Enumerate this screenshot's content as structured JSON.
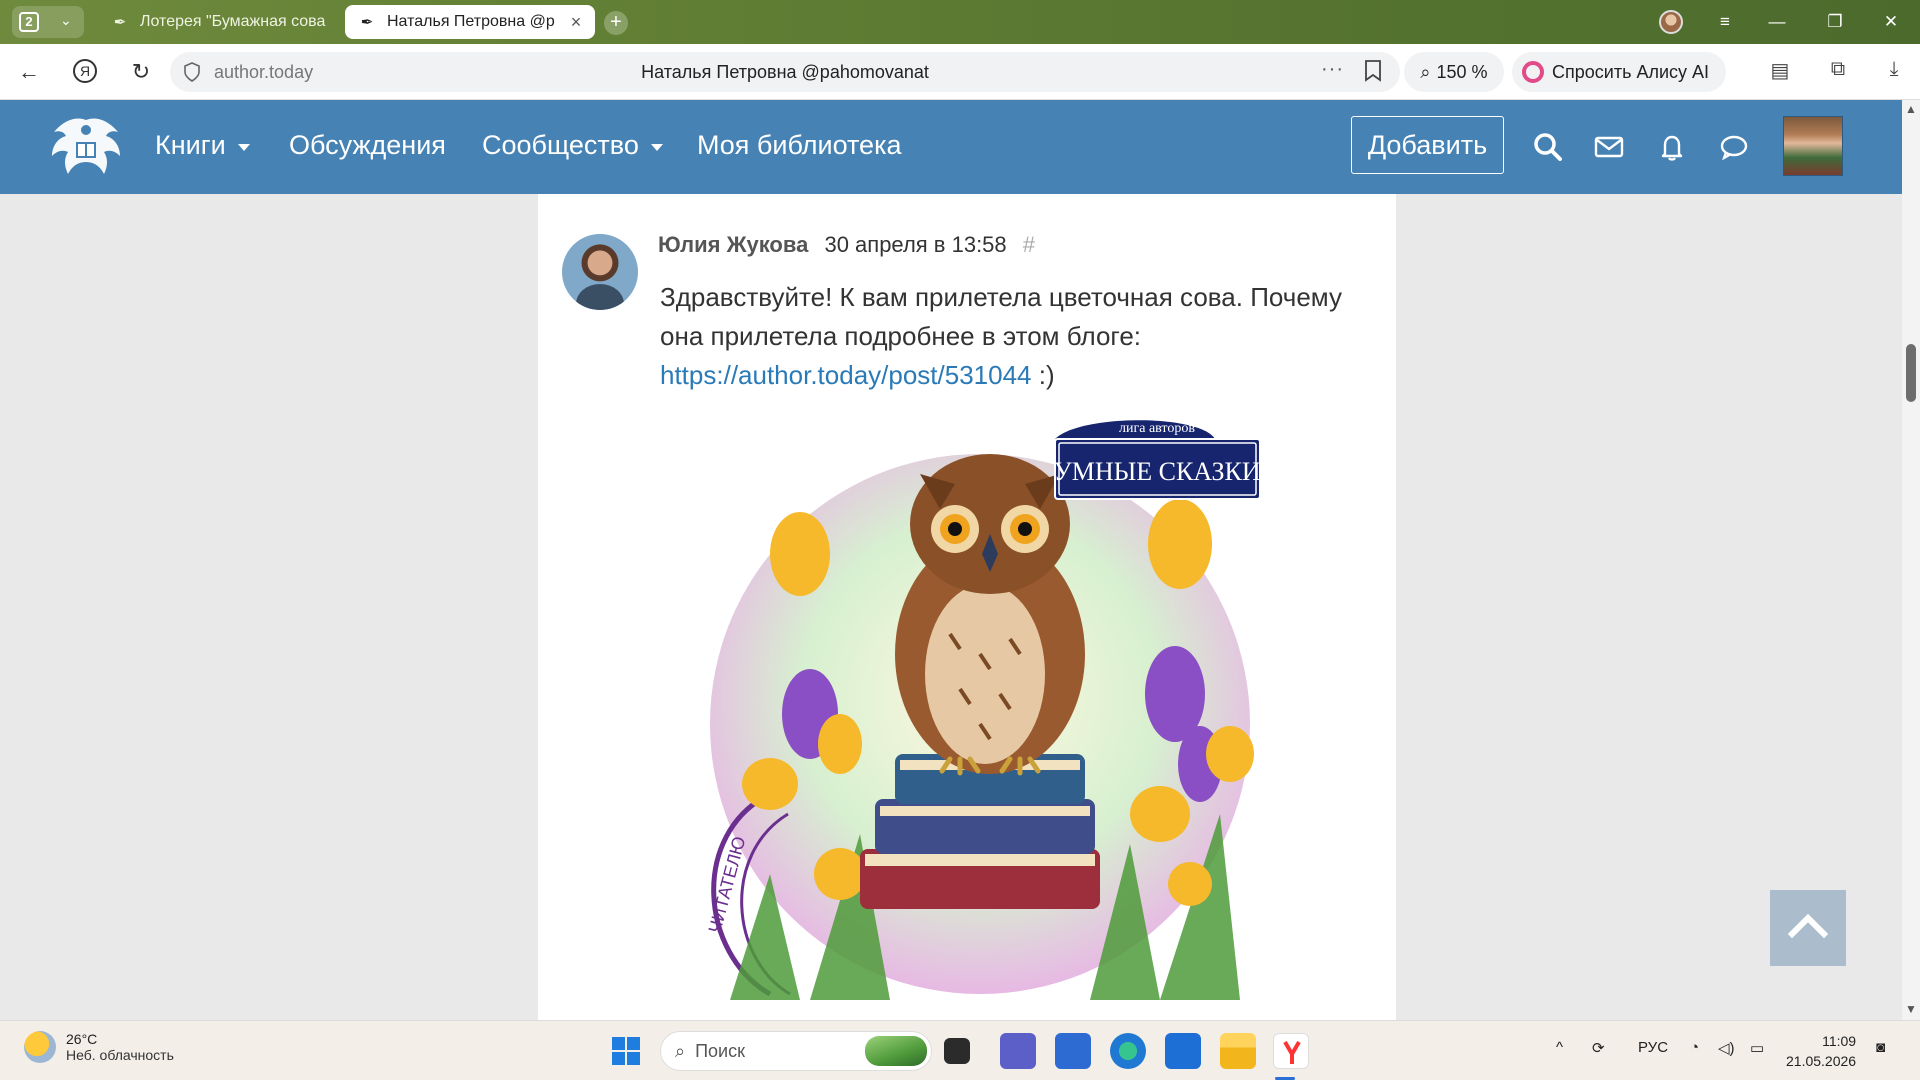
{
  "browser": {
    "tab_count": "2",
    "tabs": [
      {
        "label": "Лотерея \"Бумажная сова",
        "active": false
      },
      {
        "label": "Наталья Петровна @p",
        "active": true
      }
    ],
    "address": {
      "domain": "author.today",
      "page_title": "Наталья Петровна @pahomovanat",
      "zoom": "150 %",
      "alice_label": "Спросить Алису AI"
    }
  },
  "site": {
    "nav": {
      "books": "Книги",
      "discussions": "Обсуждения",
      "community": "Сообщество",
      "library": "Моя библиотека"
    },
    "add_button": "Добавить"
  },
  "post": {
    "author": "Юлия Жукова",
    "date": "30 апреля в 13:58",
    "hash": "#",
    "text_before": "Здравствуйте! К вам прилетела цветочная сова. Почему она прилетела подробнее в этом блоге: ",
    "link": "https://author.today/post/531044",
    "text_after": " :)",
    "image": {
      "badge_arc": "лига авторов",
      "badge_title": "УМНЫЕ СКАЗКИ",
      "stamp_text": "ЧИТАТЕЛЮ"
    }
  },
  "taskbar": {
    "weather_temp": "26°C",
    "weather_desc": "Неб. облачность",
    "search_placeholder": "Поиск",
    "lang": "РУС",
    "time": "11:09",
    "date": "21.05.2026"
  },
  "colors": {
    "site_header": "#4682b4",
    "link": "#2a7ab8",
    "tabbar": "#5f7d33"
  }
}
